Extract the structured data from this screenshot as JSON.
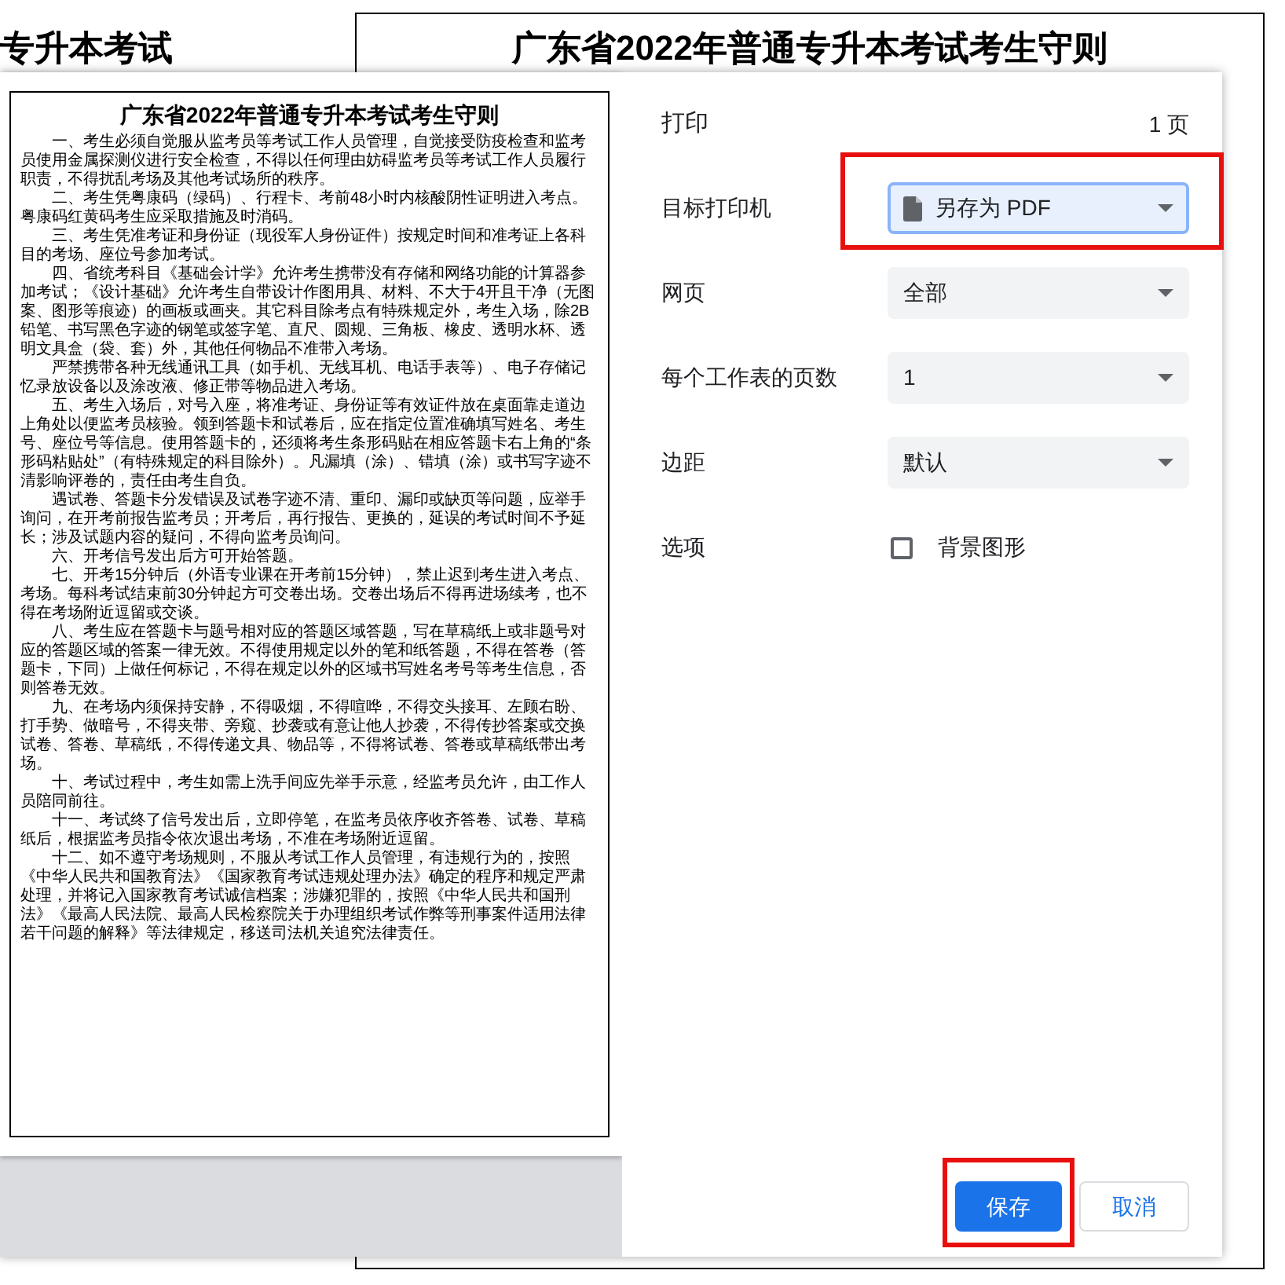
{
  "background_document": {
    "side_heading": "专升本考试",
    "title": "广东省2022年普通专升本考试考生守则"
  },
  "print_dialog": {
    "preview": {
      "title": "广东省2022年普通专升本考试考生守则",
      "paragraphs": [
        "一、考生必须自觉服从监考员等考试工作人员管理，自觉接受防疫检查和监考员使用金属探测仪进行安全检查，不得以任何理由妨碍监考员等考试工作人员履行职责，不得扰乱考场及其他考试场所的秩序。",
        "二、考生凭粤康码（绿码）、行程卡、考前48小时内核酸阴性证明进入考点。粤康码红黄码考生应采取措施及时消码。",
        "三、考生凭准考证和身份证（现役军人身份证件）按规定时间和准考证上各科目的考场、座位号参加考试。",
        "四、省统考科目《基础会计学》允许考生携带没有存储和网络功能的计算器参加考试；《设计基础》允许考生自带设计作图用具、材料、不大于4开且干净（无图案、图形等痕迹）的画板或画夹。其它科目除考点有特殊规定外，考生入场，除2B铅笔、书写黑色字迹的钢笔或签字笔、直尺、圆规、三角板、橡皮、透明水杯、透明文具盒（袋、套）外，其他任何物品不准带入考场。",
        "严禁携带各种无线通讯工具（如手机、无线耳机、电话手表等）、电子存储记忆录放设备以及涂改液、修正带等物品进入考场。",
        "五、考生入场后，对号入座，将准考证、身份证等有效证件放在桌面靠走道边上角处以便监考员核验。领到答题卡和试卷后，应在指定位置准确填写姓名、考生号、座位号等信息。使用答题卡的，还须将考生条形码贴在相应答题卡右上角的“条形码粘贴处”（有特殊规定的科目除外）。凡漏填（涂）、错填（涂）或书写字迹不清影响评卷的，责任由考生自负。",
        "遇试卷、答题卡分发错误及试卷字迹不清、重印、漏印或缺页等问题，应举手询问，在开考前报告监考员；开考后，再行报告、更换的，延误的考试时间不予延长；涉及试题内容的疑问，不得向监考员询问。",
        "六、开考信号发出后方可开始答题。",
        "七、开考15分钟后（外语专业课在开考前15分钟），禁止迟到考生进入考点、考场。每科考试结束前30分钟起方可交卷出场。交卷出场后不得再进场续考，也不得在考场附近逗留或交谈。",
        "八、考生应在答题卡与题号相对应的答题区域答题，写在草稿纸上或非题号对应的答题区域的答案一律无效。不得使用规定以外的笔和纸答题，不得在答卷（答题卡，下同）上做任何标记，不得在规定以外的区域书写姓名考号等考生信息，否则答卷无效。",
        "九、在考场内须保持安静，不得吸烟，不得喧哗，不得交头接耳、左顾右盼、打手势、做暗号，不得夹带、旁窥、抄袭或有意让他人抄袭，不得传抄答案或交换试卷、答卷、草稿纸，不得传递文具、物品等，不得将试卷、答卷或草稿纸带出考场。",
        "十、考试过程中，考生如需上洗手间应先举手示意，经监考员允许，由工作人员陪同前往。",
        "十一、考试终了信号发出后，立即停笔，在监考员依序收齐答卷、试卷、草稿纸后，根据监考员指令依次退出考场，不准在考场附近逗留。",
        "十二、如不遵守考场规则，不服从考试工作人员管理，有违规行为的，按照《中华人民共和国教育法》《国家教育考试违规处理办法》确定的程序和规定严肃处理，并将记入国家教育考试诚信档案；涉嫌犯罪的，按照《中华人民共和国刑法》《最高人民法院、最高人民检察院关于办理组织考试作弊等刑事案件适用法律若干问题的解释》等法律规定，移送司法机关追究法律责任。"
      ]
    },
    "header": {
      "label": "打印",
      "page_count": "1 页"
    },
    "settings": [
      {
        "kind": "destination",
        "label": "目标打印机",
        "value": "另存为 PDF",
        "focused": true,
        "highlighted": true
      },
      {
        "kind": "dropdown",
        "label": "网页",
        "value": "全部",
        "focused": false,
        "highlighted": false
      },
      {
        "kind": "dropdown",
        "label": "每个工作表的页数",
        "value": "1",
        "focused": false,
        "highlighted": false
      },
      {
        "kind": "dropdown",
        "label": "边距",
        "value": "默认",
        "focused": false,
        "highlighted": false
      },
      {
        "kind": "checkbox",
        "label": "选项",
        "option": "背景图形",
        "checked": false,
        "highlighted": false
      }
    ],
    "buttons": [
      {
        "label": "保存",
        "primary": true,
        "highlighted": true
      },
      {
        "label": "取消",
        "primary": false,
        "highlighted": false
      }
    ]
  }
}
